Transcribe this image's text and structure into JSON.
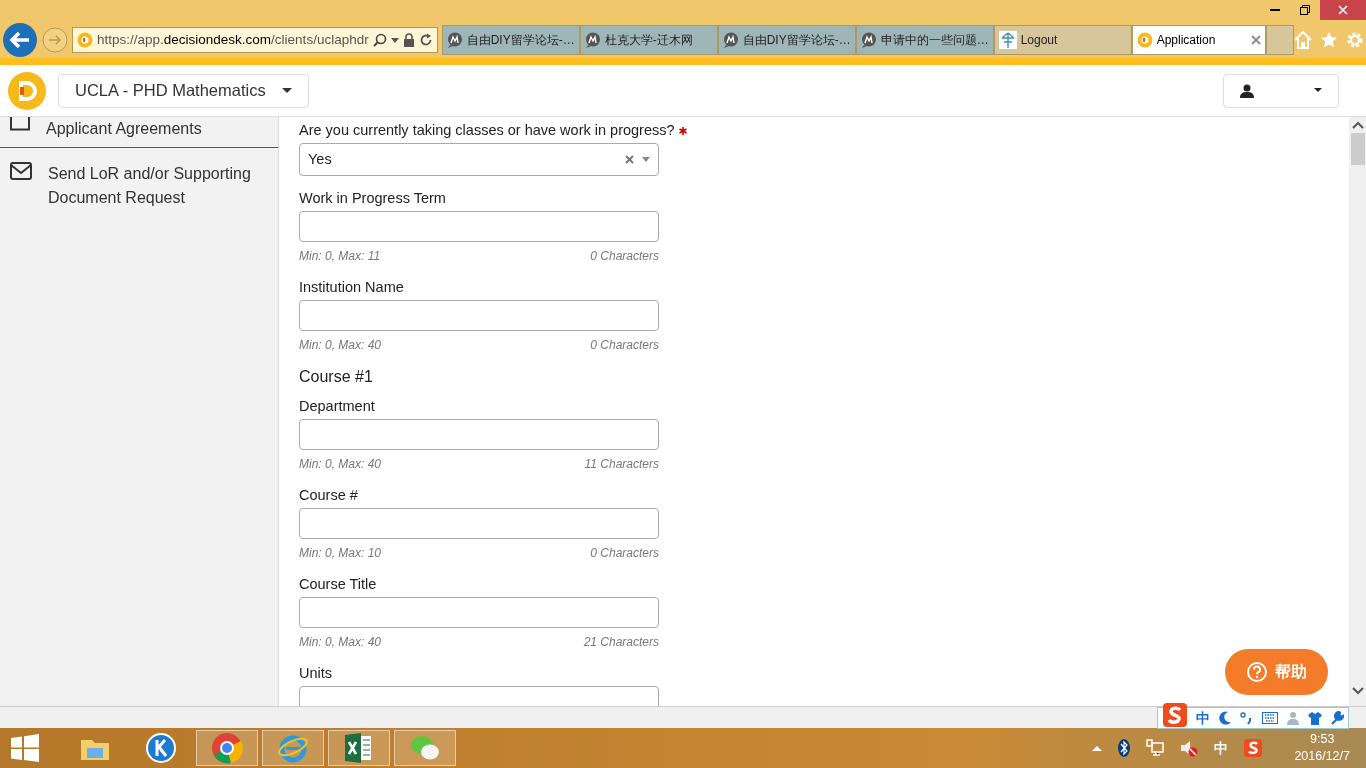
{
  "browser": {
    "address": {
      "prefix": "https://app.",
      "domain": "decisiondesk.com",
      "path": "/clients/uclaphdr"
    },
    "tabs": [
      {
        "label": "自由DIY留学论坛-…",
        "kind": "forum",
        "selected": false
      },
      {
        "label": "杜克大学-迁木网",
        "kind": "forum",
        "selected": false
      },
      {
        "label": "自由DIY留学论坛-…",
        "kind": "forum",
        "selected": false
      },
      {
        "label": "申请中的一些问题…",
        "kind": "forum",
        "selected": false
      },
      {
        "label": "Logout",
        "kind": "tree",
        "selected": false
      },
      {
        "label": "Application",
        "kind": "brand",
        "selected": true
      }
    ]
  },
  "app": {
    "program": "UCLA - PHD Mathematics"
  },
  "sidebar": {
    "items": [
      {
        "label": "Applicant Agreements",
        "kind": "checkbox"
      },
      {
        "label": "Send LoR and/or Supporting Document Request",
        "kind": "envelope"
      }
    ]
  },
  "form": {
    "fields": [
      {
        "kind": "select",
        "label": "Are you currently taking classes or have work in progress?",
        "required": true,
        "value": "Yes"
      },
      {
        "kind": "text",
        "label": "Work in Progress Term",
        "limits": "Min: 0, Max: 11",
        "count": "0 Characters"
      },
      {
        "kind": "text",
        "label": "Institution Name",
        "limits": "Min: 0, Max: 40",
        "count": "0 Characters"
      },
      {
        "kind": "heading",
        "label": "Course #1"
      },
      {
        "kind": "text",
        "label": "Department",
        "limits": "Min: 0, Max: 40",
        "count": "11 Characters"
      },
      {
        "kind": "text",
        "label": "Course #",
        "limits": "Min: 0, Max: 10",
        "count": "0 Characters"
      },
      {
        "kind": "text",
        "label": "Course Title",
        "limits": "Min: 0, Max: 40",
        "count": "21 Characters"
      },
      {
        "kind": "text",
        "label": "Units"
      }
    ]
  },
  "help_button": {
    "label": "帮助"
  },
  "ime_bar": {
    "mode": "中"
  },
  "tray": {
    "ime": "中",
    "time": "9:53",
    "date": "2016/12/7"
  }
}
